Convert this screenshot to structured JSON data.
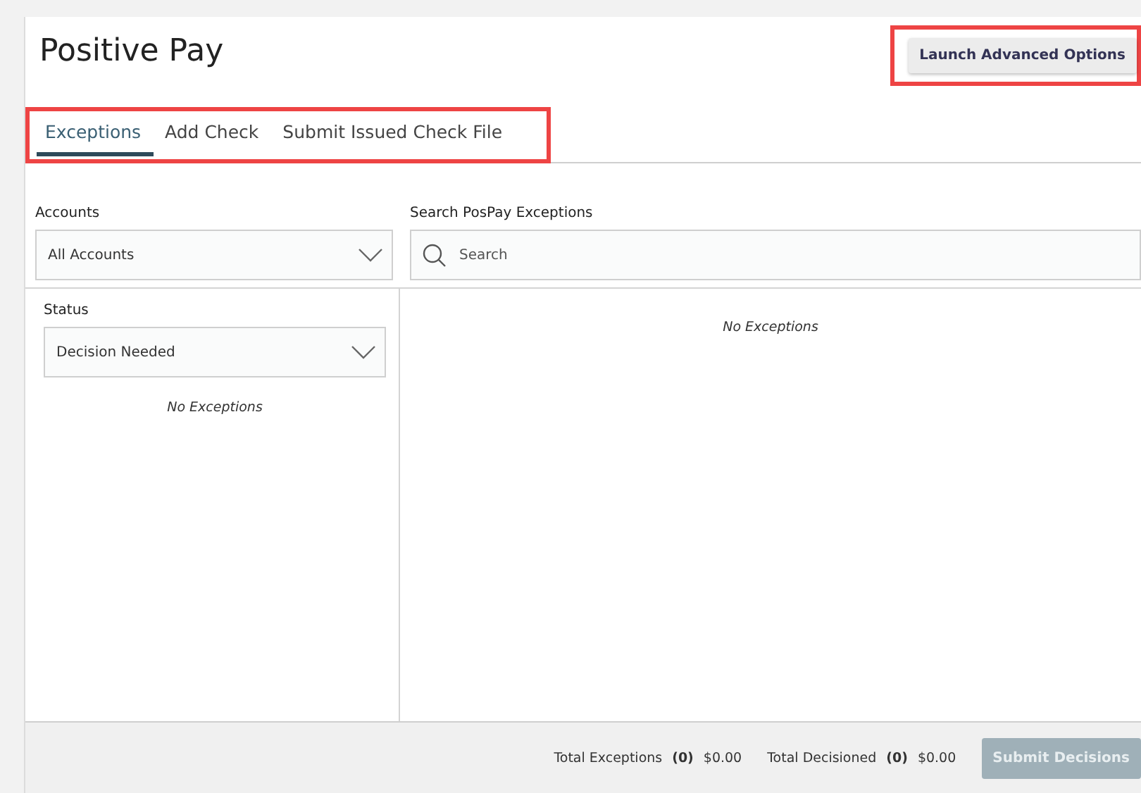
{
  "title": "Positive Pay",
  "advanced_button": {
    "label": "Launch Advanced Options",
    "highlighted": true
  },
  "tabs_highlighted": true,
  "tabs": [
    {
      "label": "Exceptions",
      "selected": true
    },
    {
      "label": "Add Check",
      "selected": false
    },
    {
      "label": "Submit Issued Check File",
      "selected": false
    }
  ],
  "accounts": {
    "label": "Accounts",
    "value": "All Accounts"
  },
  "search": {
    "label": "Search PosPay Exceptions",
    "placeholder": "Search"
  },
  "status": {
    "label": "Status",
    "value": "Decision Needed"
  },
  "status_empty": "No Exceptions",
  "results_empty": "No Exceptions",
  "footer": {
    "totals": [
      {
        "label": "Total Exceptions",
        "count": "(0)",
        "amount": "$0.00"
      },
      {
        "label": "Total Decisioned",
        "count": "(0)",
        "amount": "$0.00"
      }
    ],
    "submit": {
      "label": "Submit Decisions",
      "disabled": true
    }
  }
}
